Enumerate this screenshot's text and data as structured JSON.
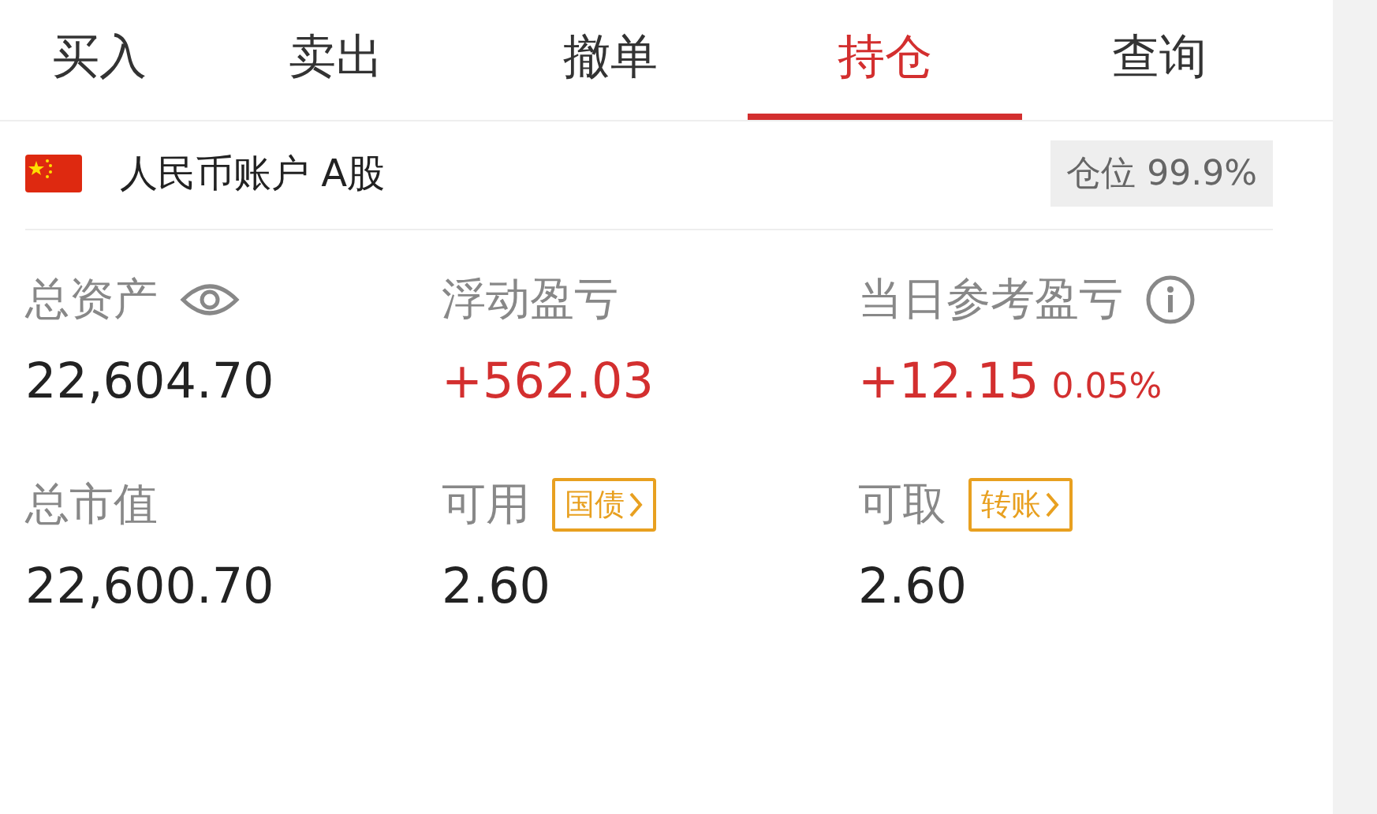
{
  "tabs": [
    {
      "label": "买入",
      "selected": false
    },
    {
      "label": "卖出",
      "selected": false
    },
    {
      "label": "撤单",
      "selected": false
    },
    {
      "label": "持仓",
      "selected": true
    },
    {
      "label": "查询",
      "selected": false
    }
  ],
  "account": {
    "name": "人民币账户 A股",
    "position": "仓位 99.9%"
  },
  "stats": [
    {
      "label": "总资产",
      "kind": "eye",
      "value": "22,604.70",
      "color": "#222222"
    },
    {
      "label": "浮动盈亏",
      "kind": "plain",
      "value": "+562.03",
      "color": "#d32f2f"
    },
    {
      "label": "当日参考盈亏",
      "kind": "info",
      "value": "+12.15",
      "color": "#d32f2f",
      "percent": "0.05%"
    },
    {
      "label": "总市值",
      "kind": "plain",
      "value": "22,600.70",
      "color": "#222222"
    },
    {
      "label": "可用",
      "kind": "link",
      "link": "国债",
      "value": "2.60",
      "color": "#222222"
    },
    {
      "label": "可取",
      "kind": "link",
      "link": "转账",
      "value": "2.60",
      "color": "#222222"
    }
  ]
}
